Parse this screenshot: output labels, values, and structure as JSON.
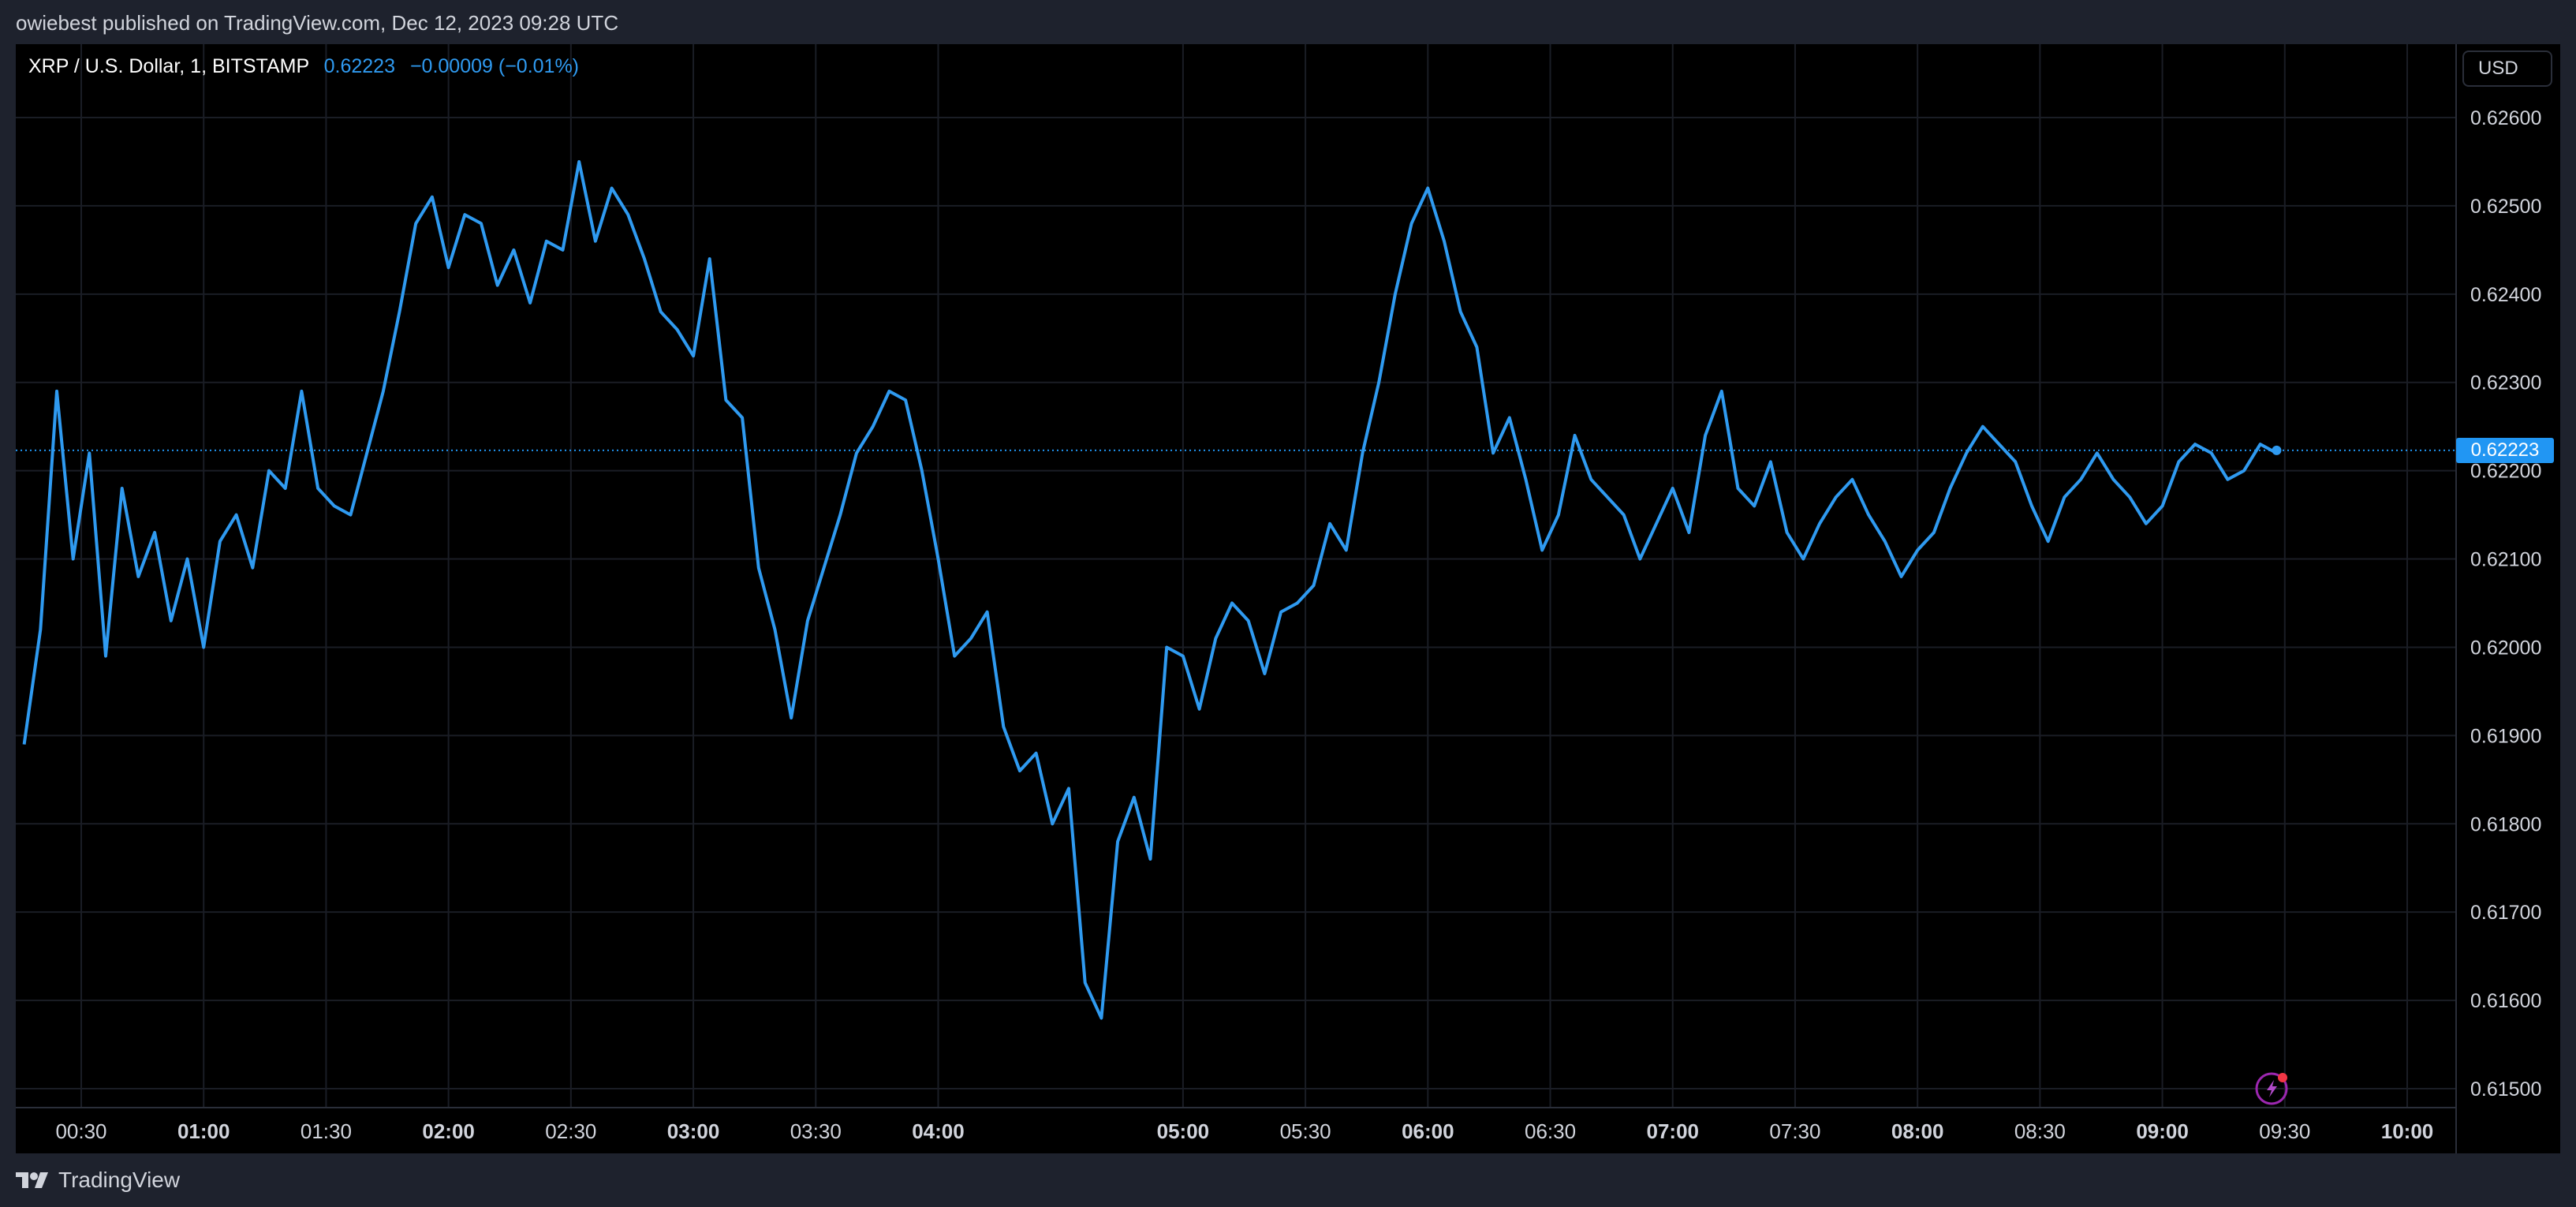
{
  "header": {
    "published_line": "owiebest published on TradingView.com, Dec 12, 2023 09:28 UTC"
  },
  "symbol": {
    "name": "XRP / U.S. Dollar, 1, BITSTAMP",
    "price": "0.62223",
    "change": "−0.00009 (−0.01%)"
  },
  "currency": "USD",
  "last_price_label": "0.62223",
  "footer": {
    "brand": "TradingView"
  },
  "colors": {
    "page_background": "#1e222d",
    "chart_background": "#000000",
    "line": "#2f9af0",
    "last_price_badge": "#2196f3",
    "text": "#d1d4dc"
  },
  "icons": {
    "footer_logo": "tradingview-logo-icon",
    "lightning": "lightning-icon"
  },
  "chart_data": {
    "type": "line",
    "xlabel": "",
    "ylabel": "",
    "grid": true,
    "xlim": [
      "00:16",
      "10:08"
    ],
    "ylim": [
      0.6148,
      0.6262
    ],
    "y_ticks": [
      "0.61500",
      "0.61600",
      "0.61700",
      "0.61800",
      "0.61900",
      "0.62000",
      "0.62100",
      "0.62200",
      "0.62300",
      "0.62400",
      "0.62500",
      "0.62600"
    ],
    "x_ticks": [
      {
        "label": "00:30",
        "bold": false
      },
      {
        "label": "01:00",
        "bold": true
      },
      {
        "label": "01:30",
        "bold": false
      },
      {
        "label": "02:00",
        "bold": true
      },
      {
        "label": "02:30",
        "bold": false
      },
      {
        "label": "03:00",
        "bold": true
      },
      {
        "label": "03:30",
        "bold": false
      },
      {
        "label": "04:00",
        "bold": true
      },
      {
        "label": "05:00",
        "bold": true
      },
      {
        "label": "05:30",
        "bold": false
      },
      {
        "label": "06:00",
        "bold": true
      },
      {
        "label": "06:30",
        "bold": false
      },
      {
        "label": "07:00",
        "bold": true
      },
      {
        "label": "07:30",
        "bold": false
      },
      {
        "label": "08:00",
        "bold": true
      },
      {
        "label": "08:30",
        "bold": false
      },
      {
        "label": "09:00",
        "bold": true
      },
      {
        "label": "09:30",
        "bold": false
      },
      {
        "label": "10:00",
        "bold": true
      }
    ],
    "last_price": 0.62223,
    "series": [
      {
        "x": [
          "00:16",
          "00:20",
          "00:24",
          "00:28",
          "00:32",
          "00:36",
          "00:40",
          "00:44",
          "00:48",
          "00:52",
          "00:56",
          "01:00",
          "01:04",
          "01:08",
          "01:12",
          "01:16",
          "01:20",
          "01:24",
          "01:28",
          "01:32",
          "01:36",
          "01:40",
          "01:44",
          "01:48",
          "01:52",
          "01:56",
          "02:00",
          "02:04",
          "02:08",
          "02:12",
          "02:16",
          "02:20",
          "02:24",
          "02:28",
          "02:32",
          "02:36",
          "02:40",
          "02:44",
          "02:48",
          "02:52",
          "02:56",
          "03:00",
          "03:04",
          "03:08",
          "03:12",
          "03:16",
          "03:20",
          "03:24",
          "03:28",
          "03:32",
          "03:36",
          "03:40",
          "03:44",
          "03:48",
          "03:52",
          "03:56",
          "04:00",
          "04:04",
          "04:08",
          "04:12",
          "04:16",
          "04:20",
          "04:24",
          "04:28",
          "04:32",
          "04:36",
          "04:40",
          "04:44",
          "04:48",
          "04:52",
          "04:56",
          "05:00",
          "05:04",
          "05:08",
          "05:12",
          "05:16",
          "05:20",
          "05:24",
          "05:28",
          "05:32",
          "05:36",
          "05:40",
          "05:44",
          "05:48",
          "05:52",
          "05:56",
          "06:00",
          "06:04",
          "06:08",
          "06:12",
          "06:16",
          "06:20",
          "06:24",
          "06:28",
          "06:32",
          "06:36",
          "06:40",
          "06:44",
          "06:48",
          "06:52",
          "06:56",
          "07:00",
          "07:04",
          "07:08",
          "07:12",
          "07:16",
          "07:20",
          "07:24",
          "07:28",
          "07:32",
          "07:36",
          "07:40",
          "07:44",
          "07:48",
          "07:52",
          "07:56",
          "08:00",
          "08:04",
          "08:08",
          "08:12",
          "08:16",
          "08:20",
          "08:24",
          "08:28",
          "08:32",
          "08:36",
          "08:40",
          "08:44",
          "08:48",
          "08:52",
          "08:56",
          "09:00",
          "09:04",
          "09:08",
          "09:12",
          "09:16",
          "09:20",
          "09:24",
          "09:28"
        ],
        "values": [
          0.6189,
          0.6202,
          0.6229,
          0.621,
          0.6222,
          0.6199,
          0.6218,
          0.6208,
          0.6213,
          0.6203,
          0.621,
          0.62,
          0.6212,
          0.6215,
          0.6209,
          0.622,
          0.6218,
          0.6229,
          0.6218,
          0.6216,
          0.6215,
          0.6222,
          0.6229,
          0.6238,
          0.6248,
          0.6251,
          0.6243,
          0.6249,
          0.6248,
          0.6241,
          0.6245,
          0.6239,
          0.6246,
          0.6245,
          0.6255,
          0.6246,
          0.6252,
          0.6249,
          0.6244,
          0.6238,
          0.6236,
          0.6233,
          0.6244,
          0.6228,
          0.6226,
          0.6209,
          0.6202,
          0.6192,
          0.6203,
          0.6209,
          0.6215,
          0.6222,
          0.6225,
          0.6229,
          0.6228,
          0.622,
          0.621,
          0.6199,
          0.6201,
          0.6204,
          0.6191,
          0.6186,
          0.6188,
          0.618,
          0.6184,
          0.6162,
          0.6158,
          0.6178,
          0.6183,
          0.6176,
          0.62,
          0.6199,
          0.6193,
          0.6201,
          0.6205,
          0.6203,
          0.6197,
          0.6204,
          0.6205,
          0.6207,
          0.6214,
          0.6211,
          0.6222,
          0.623,
          0.624,
          0.6248,
          0.6252,
          0.6246,
          0.6238,
          0.6234,
          0.6222,
          0.6226,
          0.6219,
          0.6211,
          0.6215,
          0.6224,
          0.6219,
          0.6217,
          0.6215,
          0.621,
          0.6214,
          0.6218,
          0.6213,
          0.6224,
          0.6229,
          0.6218,
          0.6216,
          0.6221,
          0.6213,
          0.621,
          0.6214,
          0.6217,
          0.6219,
          0.6215,
          0.6212,
          0.6208,
          0.6211,
          0.6213,
          0.6218,
          0.6222,
          0.6225,
          0.6223,
          0.6221,
          0.6216,
          0.6212,
          0.6217,
          0.6219,
          0.6222,
          0.6219,
          0.6217,
          0.6214,
          0.6216,
          0.6221,
          0.6223,
          0.6222,
          0.6219,
          0.622,
          0.6223,
          0.6222
        ]
      }
    ]
  }
}
